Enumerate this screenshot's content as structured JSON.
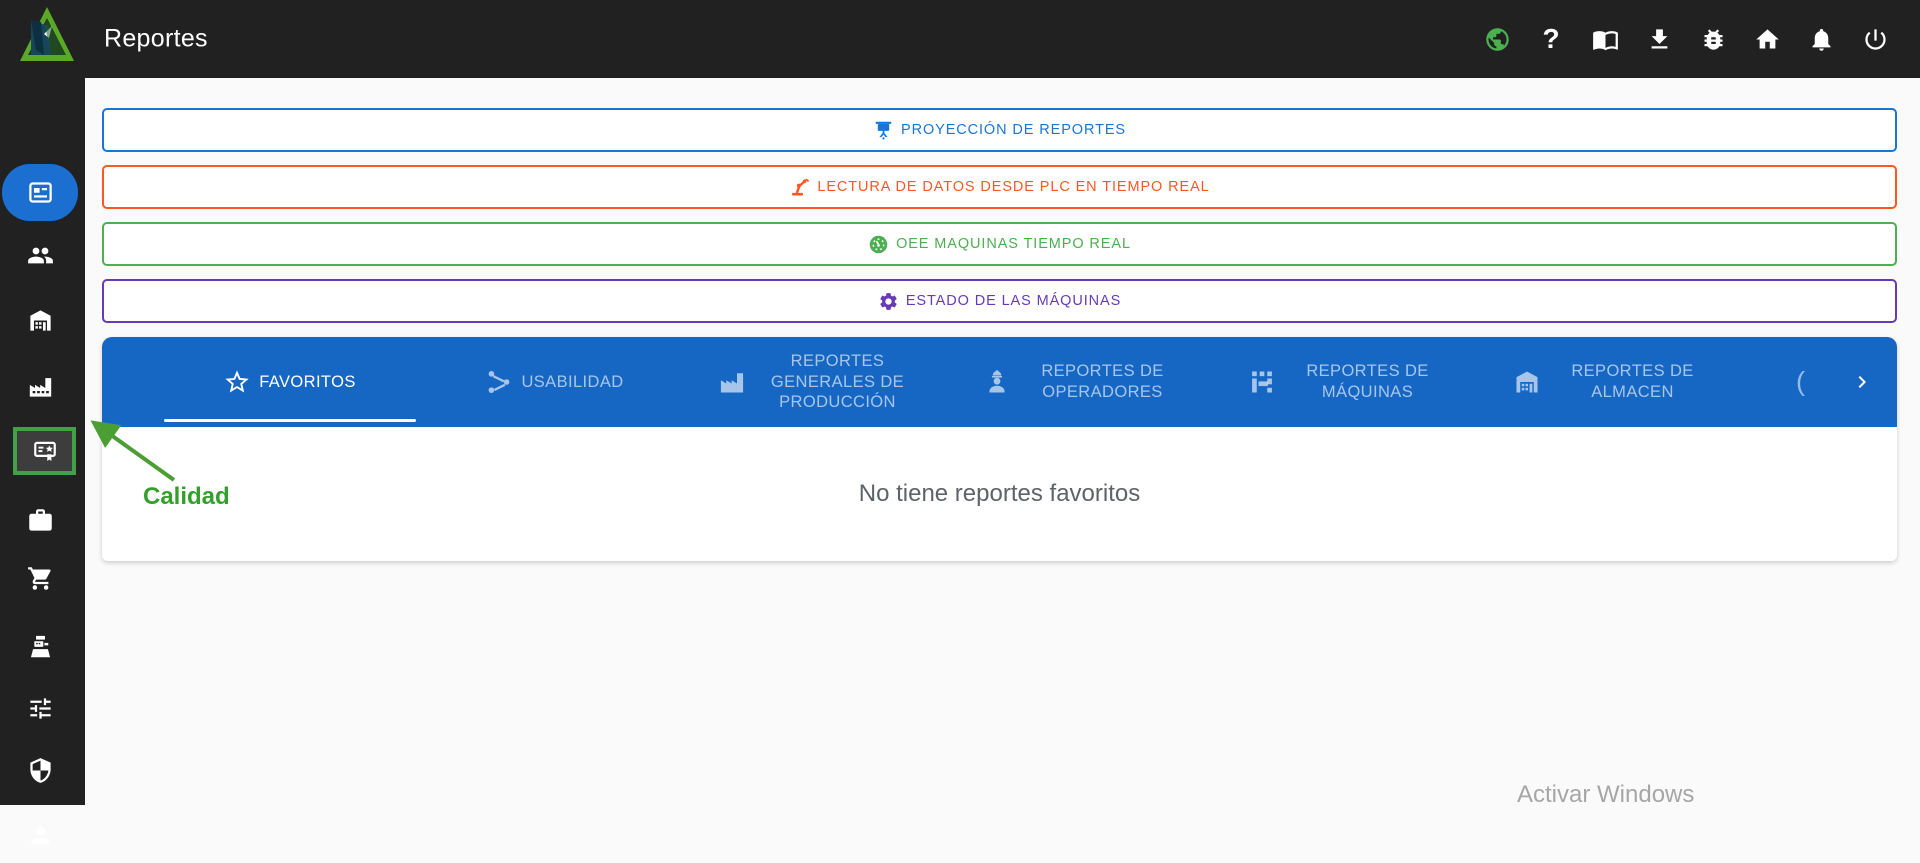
{
  "app": {
    "title": "Reportes"
  },
  "topbar": {
    "help_glyph": "?",
    "icons": [
      "globe",
      "help",
      "book",
      "download",
      "bug",
      "home",
      "notifications",
      "power"
    ]
  },
  "sidebar": {
    "items": [
      "reportes",
      "usuarios",
      "almacen",
      "produccion",
      "calidad",
      "trabajo",
      "compras",
      "ventas",
      "configuracion",
      "seguridad",
      "cuenta"
    ],
    "active_item": "reportes",
    "highlighted_item": "calidad"
  },
  "banners": [
    {
      "label": "PROYECCIÓN DE REPORTES",
      "color": "#1976d2",
      "icon": "projector-screen"
    },
    {
      "label": "LECTURA DE DATOS DESDE PLC EN TIEMPO REAL",
      "color": "#ff5722",
      "icon": "robotic-arm"
    },
    {
      "label": "OEE MAQUINAS TIEMPO REAL",
      "color": "#4caf50",
      "icon": "gauge"
    },
    {
      "label": "ESTADO DE LAS MÁQUINAS",
      "color": "#673ab7",
      "icon": "gear"
    }
  ],
  "tabs": {
    "items": [
      {
        "label": "FAVORITOS",
        "icon": "star",
        "active": true
      },
      {
        "label": "USABILIDAD",
        "icon": "usability",
        "active": false
      },
      {
        "label": "REPORTES GENERALES DE PRODUCCIÓN",
        "icon": "factory",
        "active": false
      },
      {
        "label": "REPORTES DE OPERADORES",
        "icon": "operator",
        "active": false
      },
      {
        "label": "REPORTES DE MÁQUINAS",
        "icon": "machine",
        "active": false
      },
      {
        "label": "REPORTES DE ALMACEN",
        "icon": "warehouse",
        "active": false
      }
    ],
    "overflow_hint": "(",
    "scroll_next": "chevron-right"
  },
  "content": {
    "empty_message": "No tiene reportes favoritos"
  },
  "annotation": {
    "label": "Calidad",
    "color": "#33a02c"
  },
  "watermark": {
    "text": "Activar Windows"
  },
  "colors": {
    "topbar_bg": "#212121",
    "tabbar_blue": "#1667c4",
    "active_pill_blue": "#1b6fd0",
    "highlight_green": "#43a047",
    "banner_blue": "#1976d2",
    "banner_orange": "#ff5722",
    "banner_green": "#4caf50",
    "banner_purple": "#673ab7"
  }
}
